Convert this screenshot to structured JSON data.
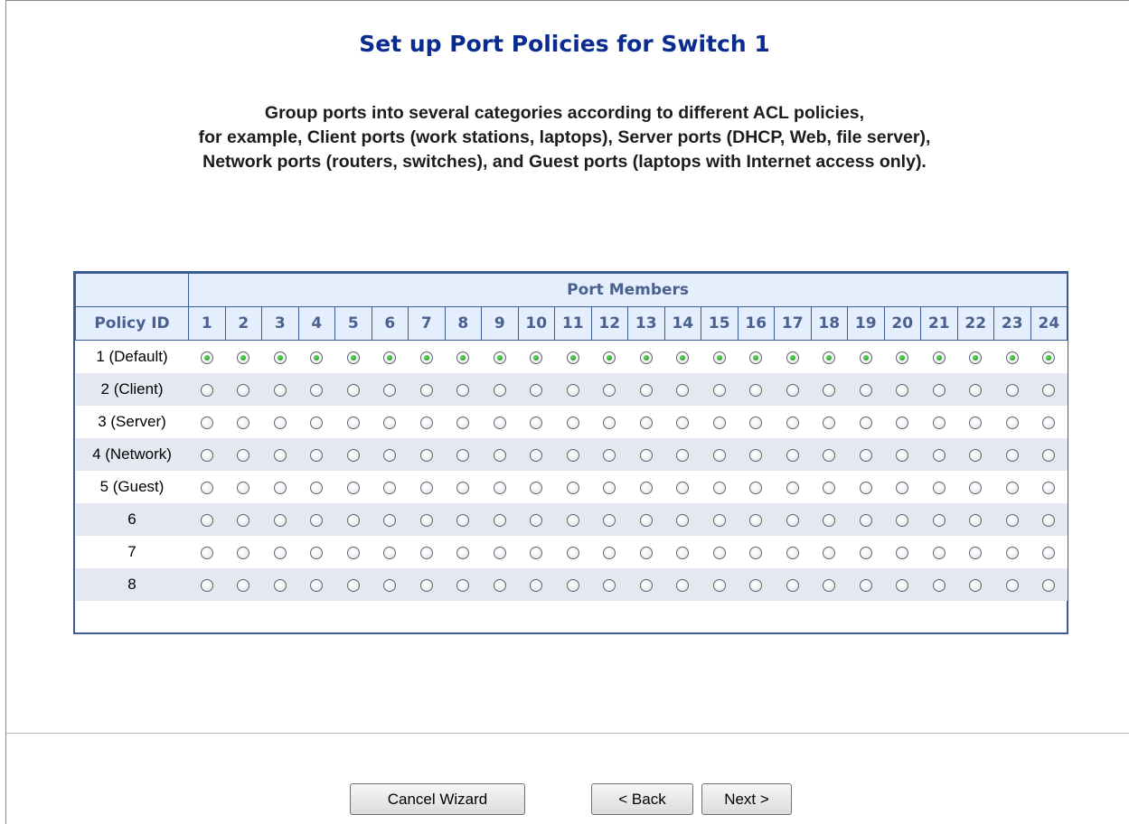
{
  "page": {
    "title": "Set up Port Policies for Switch 1",
    "description_lines": [
      "Group ports into several categories according to different ACL policies,",
      "for example, Client ports (work stations, laptops), Server ports (DHCP, Web, file server),",
      "Network ports (routers, switches), and Guest ports (laptops with Internet access only)."
    ]
  },
  "table": {
    "group_header": "Port Members",
    "policy_header": "Policy ID",
    "ports": [
      "1",
      "2",
      "3",
      "4",
      "5",
      "6",
      "7",
      "8",
      "9",
      "10",
      "11",
      "12",
      "13",
      "14",
      "15",
      "16",
      "17",
      "18",
      "19",
      "20",
      "21",
      "22",
      "23",
      "24"
    ],
    "policies": [
      {
        "label": "1 (Default)",
        "selected": true
      },
      {
        "label": "2 (Client)",
        "selected": false
      },
      {
        "label": "3 (Server)",
        "selected": false
      },
      {
        "label": "4 (Network)",
        "selected": false
      },
      {
        "label": "5 (Guest)",
        "selected": false
      },
      {
        "label": "6",
        "selected": false
      },
      {
        "label": "7",
        "selected": false
      },
      {
        "label": "8",
        "selected": false
      }
    ]
  },
  "buttons": {
    "cancel": "Cancel Wizard",
    "back": "< Back",
    "next": "Next >"
  },
  "colors": {
    "title": "#0a2b8f",
    "table_border": "#3a5d93",
    "header_bg": "#e5eefc",
    "header_text": "#4a6190",
    "row_alt_bg": "#e4e9f1",
    "radio_selected": "#22a322"
  }
}
